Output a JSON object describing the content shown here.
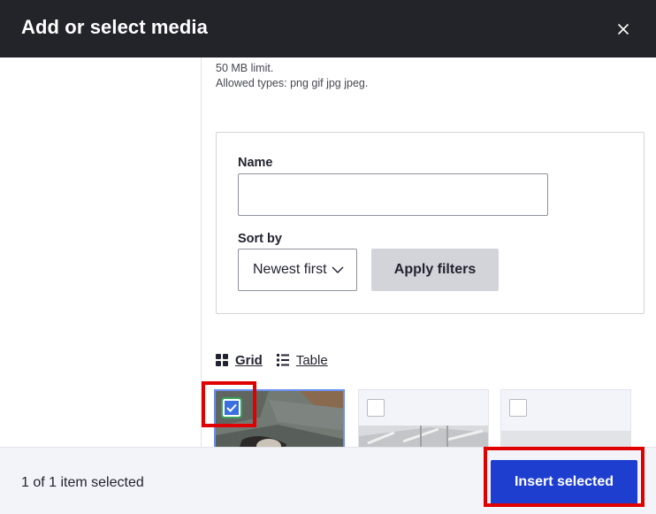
{
  "dialog": {
    "title": "Add or select media",
    "close_icon": "close-icon"
  },
  "upload_help": {
    "size_limit": "50 MB limit.",
    "allowed_types": "Allowed types: png gif jpg jpeg."
  },
  "filters": {
    "name_label": "Name",
    "name_value": "",
    "sort_label": "Sort by",
    "sort_value": "Newest first",
    "apply_label": "Apply filters"
  },
  "view_toggle": {
    "grid_label": "Grid",
    "grid_icon": "grid-icon",
    "table_label": "Table",
    "table_icon": "list-icon",
    "active": "Grid"
  },
  "media_items": [
    {
      "selected": true
    },
    {
      "selected": false
    },
    {
      "selected": false
    }
  ],
  "footer": {
    "status": "1 of 1 item selected",
    "insert_label": "Insert selected"
  },
  "colors": {
    "header_bg": "#232429",
    "primary_button": "#1e3ed0",
    "highlight": "#e00000"
  }
}
